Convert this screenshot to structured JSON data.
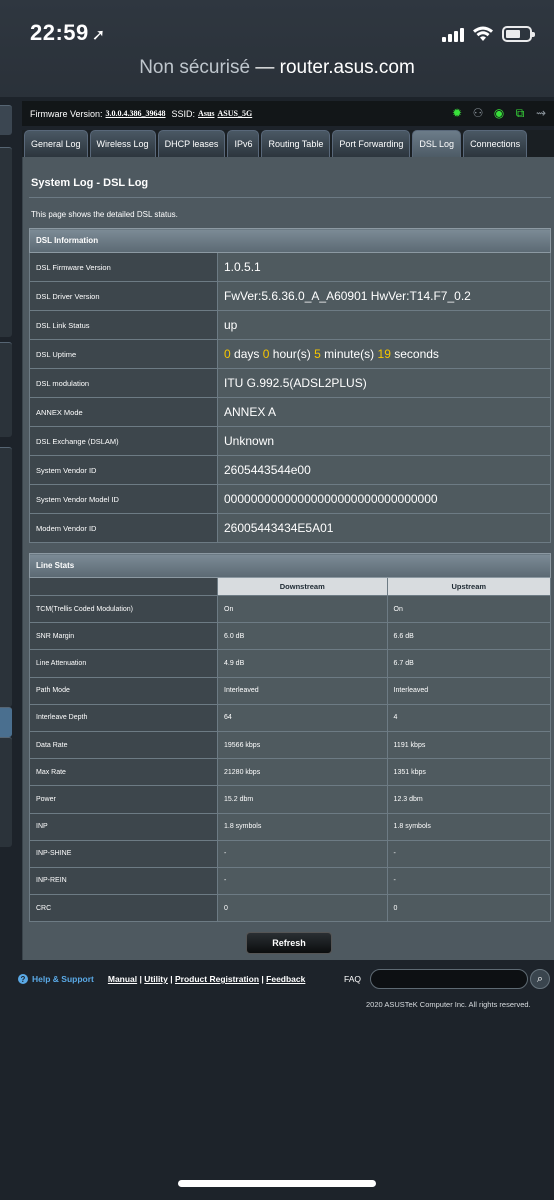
{
  "status_bar": {
    "time": "22:59",
    "location_icon": "location-arrow-icon"
  },
  "address_bar": {
    "insecure": "Non sécurisé",
    "separator": " — ",
    "domain": "router.asus.com"
  },
  "header": {
    "firmware_label": "Firmware Version:",
    "firmware_value": "3.0.0.4.386_39648",
    "ssid_label": "SSID:",
    "ssid_1": "Asus",
    "ssid_2": "ASUS_5G",
    "icons": [
      "gear-icon",
      "users-icon",
      "globe-icon",
      "network-icon",
      "usb-icon"
    ]
  },
  "tabs": [
    "General Log",
    "Wireless Log",
    "DHCP leases",
    "IPv6",
    "Routing Table",
    "Port Forwarding",
    "DSL Log",
    "Connections"
  ],
  "active_tab": "DSL Log",
  "page": {
    "title": "System Log - DSL Log",
    "description": "This page shows the detailed DSL status."
  },
  "dsl_info": {
    "section_title": "DSL Information",
    "rows": [
      {
        "label": "DSL Firmware Version",
        "value": "1.0.5.1"
      },
      {
        "label": "DSL Driver Version",
        "value": "FwVer:5.6.36.0_A_A60901 HwVer:T14.F7_0.2"
      },
      {
        "label": "DSL Link Status",
        "value": "up"
      },
      {
        "label": "DSL Uptime",
        "uptime": {
          "days": "0",
          "days_label": "days",
          "hours": "0",
          "hours_label": "hour(s)",
          "minutes": "5",
          "minutes_label": "minute(s)",
          "seconds": "19",
          "seconds_label": "seconds"
        }
      },
      {
        "label": "DSL modulation",
        "value": "ITU G.992.5(ADSL2PLUS)"
      },
      {
        "label": "ANNEX Mode",
        "value": "ANNEX A"
      },
      {
        "label": "DSL Exchange (DSLAM)",
        "value": "Unknown"
      },
      {
        "label": "System Vendor ID",
        "value": "2605443544e00"
      },
      {
        "label": "System Vendor Model ID",
        "value": "00000000000000000000000000000000"
      },
      {
        "label": "Modem Vendor ID",
        "value": "26005443434E5A01"
      }
    ]
  },
  "line_stats": {
    "section_title": "Line Stats",
    "columns": [
      "Downstream",
      "Upstream"
    ],
    "rows": [
      {
        "label": "TCM(Trellis Coded Modulation)",
        "down": "On",
        "up": "On"
      },
      {
        "label": "SNR Margin",
        "down": "6.0 dB",
        "up": "6.6 dB"
      },
      {
        "label": "Line Attenuation",
        "down": "4.9 dB",
        "up": "6.7 dB"
      },
      {
        "label": "Path Mode",
        "down": "Interleaved",
        "up": "Interleaved"
      },
      {
        "label": "Interleave Depth",
        "down": "64",
        "up": "4"
      },
      {
        "label": "Data Rate",
        "down": "19566 kbps",
        "up": "1191 kbps"
      },
      {
        "label": "Max Rate",
        "down": "21280 kbps",
        "up": "1351 kbps"
      },
      {
        "label": "Power",
        "down": "15.2 dbm",
        "up": "12.3 dbm"
      },
      {
        "label": "INP",
        "down": "1.8 symbols",
        "up": "1.8 symbols"
      },
      {
        "label": "INP-SHINE",
        "down": "-",
        "up": "-"
      },
      {
        "label": "INP-REIN",
        "down": "-",
        "up": "-"
      },
      {
        "label": "CRC",
        "down": "0",
        "up": "0"
      }
    ]
  },
  "refresh_label": "Refresh",
  "footer": {
    "help": "Help & Support",
    "links": [
      "Manual",
      "Utility",
      "Product Registration",
      "Feedback"
    ],
    "faq": "FAQ",
    "copyright": "2020 ASUSTeK Computer Inc. All rights reserved."
  },
  "colors": {
    "accent_yellow": "#f7c600",
    "help_blue": "#5aa9e6",
    "panel": "#4e5960"
  }
}
